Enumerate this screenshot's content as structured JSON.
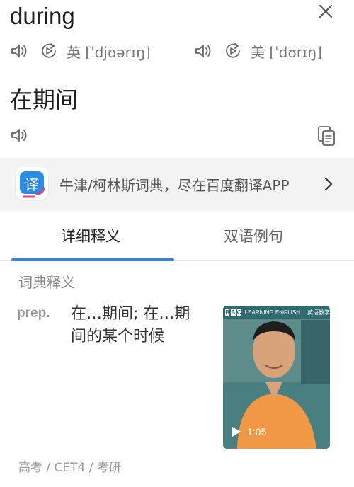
{
  "entry": {
    "word": "during",
    "uk": {
      "label": "英",
      "phonetic": "[ˈdjʊərɪŋ]"
    },
    "us": {
      "label": "美",
      "phonetic": "[ˈdʊrɪŋ]"
    }
  },
  "translation": {
    "text": "在期间"
  },
  "promo": {
    "text": "牛津/柯林斯词典，尽在百度翻译APP",
    "logo_char": "译",
    "logo_color": "#2b8ce8"
  },
  "tabs": [
    {
      "label": "详细释义",
      "active": true
    },
    {
      "label": "双语例句",
      "active": false
    }
  ],
  "dictionary": {
    "section_title": "词典释义",
    "pos": "prep.",
    "definition": "在…期间; 在…期间的某个时候"
  },
  "video": {
    "banner_brand": "LEARNING ENGLISH",
    "banner_cn": "英语教学",
    "duration": "1:05"
  },
  "exam_tags": "高考 / CET4 / 考研",
  "colors": {
    "accent": "#3a7de3",
    "muted_text": "#888888",
    "promo_bg": "#f3f3f3"
  },
  "icons": [
    "close-icon",
    "speaker-icon",
    "replay-icon",
    "copy-icon",
    "chevron-right-icon",
    "play-icon"
  ]
}
